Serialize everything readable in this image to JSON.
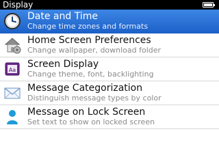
{
  "window": {
    "title": "Display"
  },
  "status": {
    "battery_level": 1.0
  },
  "items": [
    {
      "label": "Date and Time",
      "description": "Change time zones and formats",
      "icon": "clock-icon",
      "selected": true
    },
    {
      "label": "Home Screen Preferences",
      "description": "Change wallpaper, download folder",
      "icon": "home-screen-icon",
      "selected": false
    },
    {
      "label": "Screen Display",
      "description": "Change theme, font, backlighting",
      "icon": "font-icon",
      "selected": false
    },
    {
      "label": "Message Categorization",
      "description": "Distinguish message types by color",
      "icon": "envelope-icon",
      "selected": false
    },
    {
      "label": "Message on Lock Screen",
      "description": "Set text to show on locked screen",
      "icon": "person-icon",
      "selected": false
    }
  ],
  "colors": {
    "selection": "#2a72d8",
    "divider": "#d6d6d6"
  }
}
